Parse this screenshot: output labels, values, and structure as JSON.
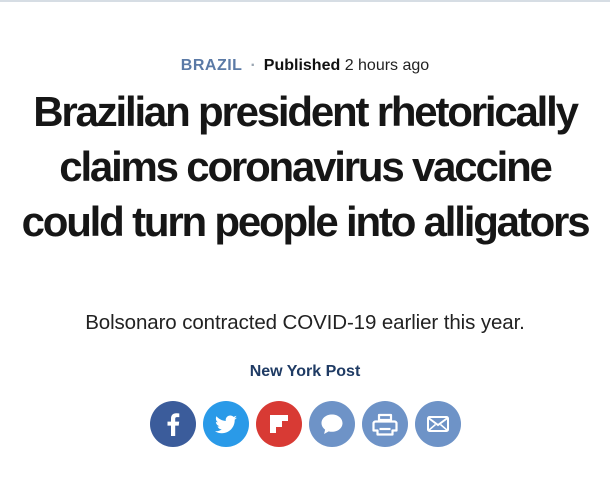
{
  "article": {
    "section": "BRAZIL",
    "separator": "·",
    "published_label": "Published",
    "published_time": "2 hours ago",
    "headline": "Brazilian president rhetorically claims coronavirus vaccine could turn people into alligators",
    "subheadline": "Bolsonaro contracted COVID-19 earlier this year.",
    "source": "New York Post"
  },
  "share": {
    "buttons": [
      {
        "icon": "facebook-icon",
        "color": "#3b5c9b"
      },
      {
        "icon": "twitter-icon",
        "color": "#2a9ae8"
      },
      {
        "icon": "flipboard-icon",
        "color": "#d83a34"
      },
      {
        "icon": "chat-bubble-icon",
        "color": "#6e93c7"
      },
      {
        "icon": "print-icon",
        "color": "#6e93c7"
      },
      {
        "icon": "email-icon",
        "color": "#6e93c7"
      }
    ]
  },
  "colors": {
    "section": "#5b7aa6",
    "headline": "#161616",
    "source": "#1f3b64"
  }
}
